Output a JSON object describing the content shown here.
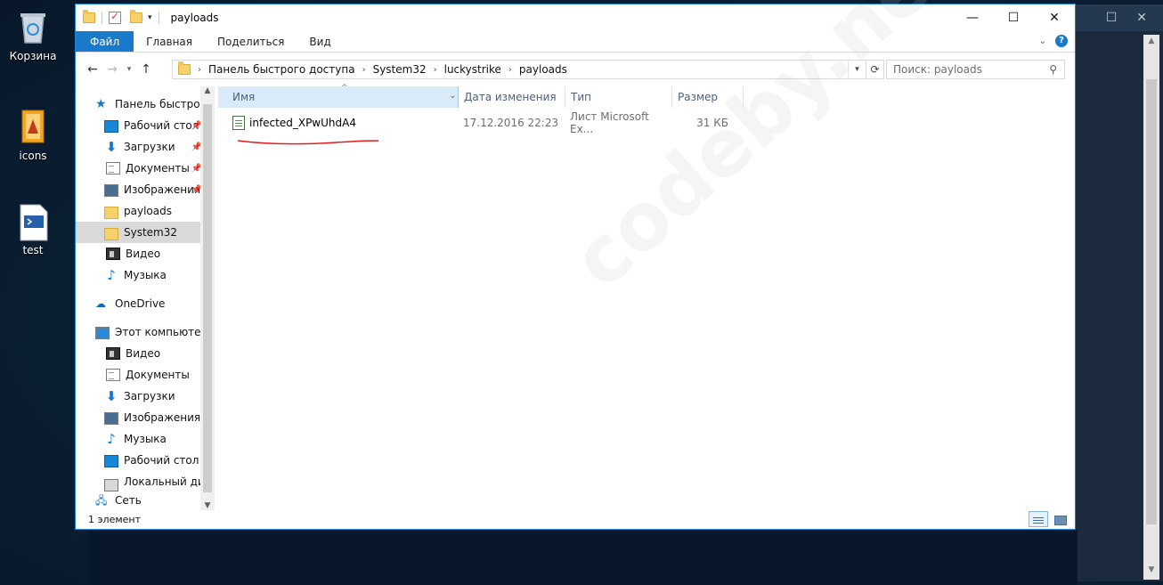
{
  "desktop": {
    "icons": [
      {
        "label": "Корзина",
        "icon": "recycle-bin-icon"
      },
      {
        "label": "icons",
        "icon": "archive-icon"
      },
      {
        "label": "test",
        "icon": "powershell-script-icon"
      }
    ]
  },
  "window": {
    "title": "payloads",
    "controls": {
      "minimize": "—",
      "maximize": "☐",
      "close": "✕"
    }
  },
  "ribbon": {
    "tabs": [
      "Файл",
      "Главная",
      "Поделиться",
      "Вид"
    ]
  },
  "address": {
    "crumbs": [
      "Панель быстрого доступа",
      "System32",
      "luckystrike",
      "payloads"
    ]
  },
  "search": {
    "placeholder": "Поиск: payloads"
  },
  "nav": {
    "quick_access": "Панель быстрого доступа",
    "quick_items": [
      {
        "label": "Рабочий стол",
        "pinned": true
      },
      {
        "label": "Загрузки",
        "pinned": true
      },
      {
        "label": "Документы",
        "pinned": true
      },
      {
        "label": "Изображения",
        "pinned": true
      },
      {
        "label": "payloads",
        "pinned": false
      },
      {
        "label": "System32",
        "pinned": false,
        "selected": true
      },
      {
        "label": "Видео",
        "pinned": false
      },
      {
        "label": "Музыка",
        "pinned": false
      }
    ],
    "onedrive": "OneDrive",
    "this_pc": "Этот компьютер",
    "pc_items": [
      "Видео",
      "Документы",
      "Загрузки",
      "Изображения",
      "Музыка",
      "Рабочий стол",
      "Локальный диск"
    ],
    "network": "Сеть"
  },
  "columns": {
    "name": "Имя",
    "date": "Дата изменения",
    "type": "Тип",
    "size": "Размер"
  },
  "files": [
    {
      "name": "infected_XPwUhdA4",
      "date": "17.12.2016 22:23",
      "type": "Лист Microsoft Ex...",
      "size": "31 КБ"
    }
  ],
  "status": {
    "count": "1 элемент"
  },
  "watermark": "codeby.net",
  "colors": {
    "accent": "#1979ca",
    "annotation": "#e31b1b"
  }
}
